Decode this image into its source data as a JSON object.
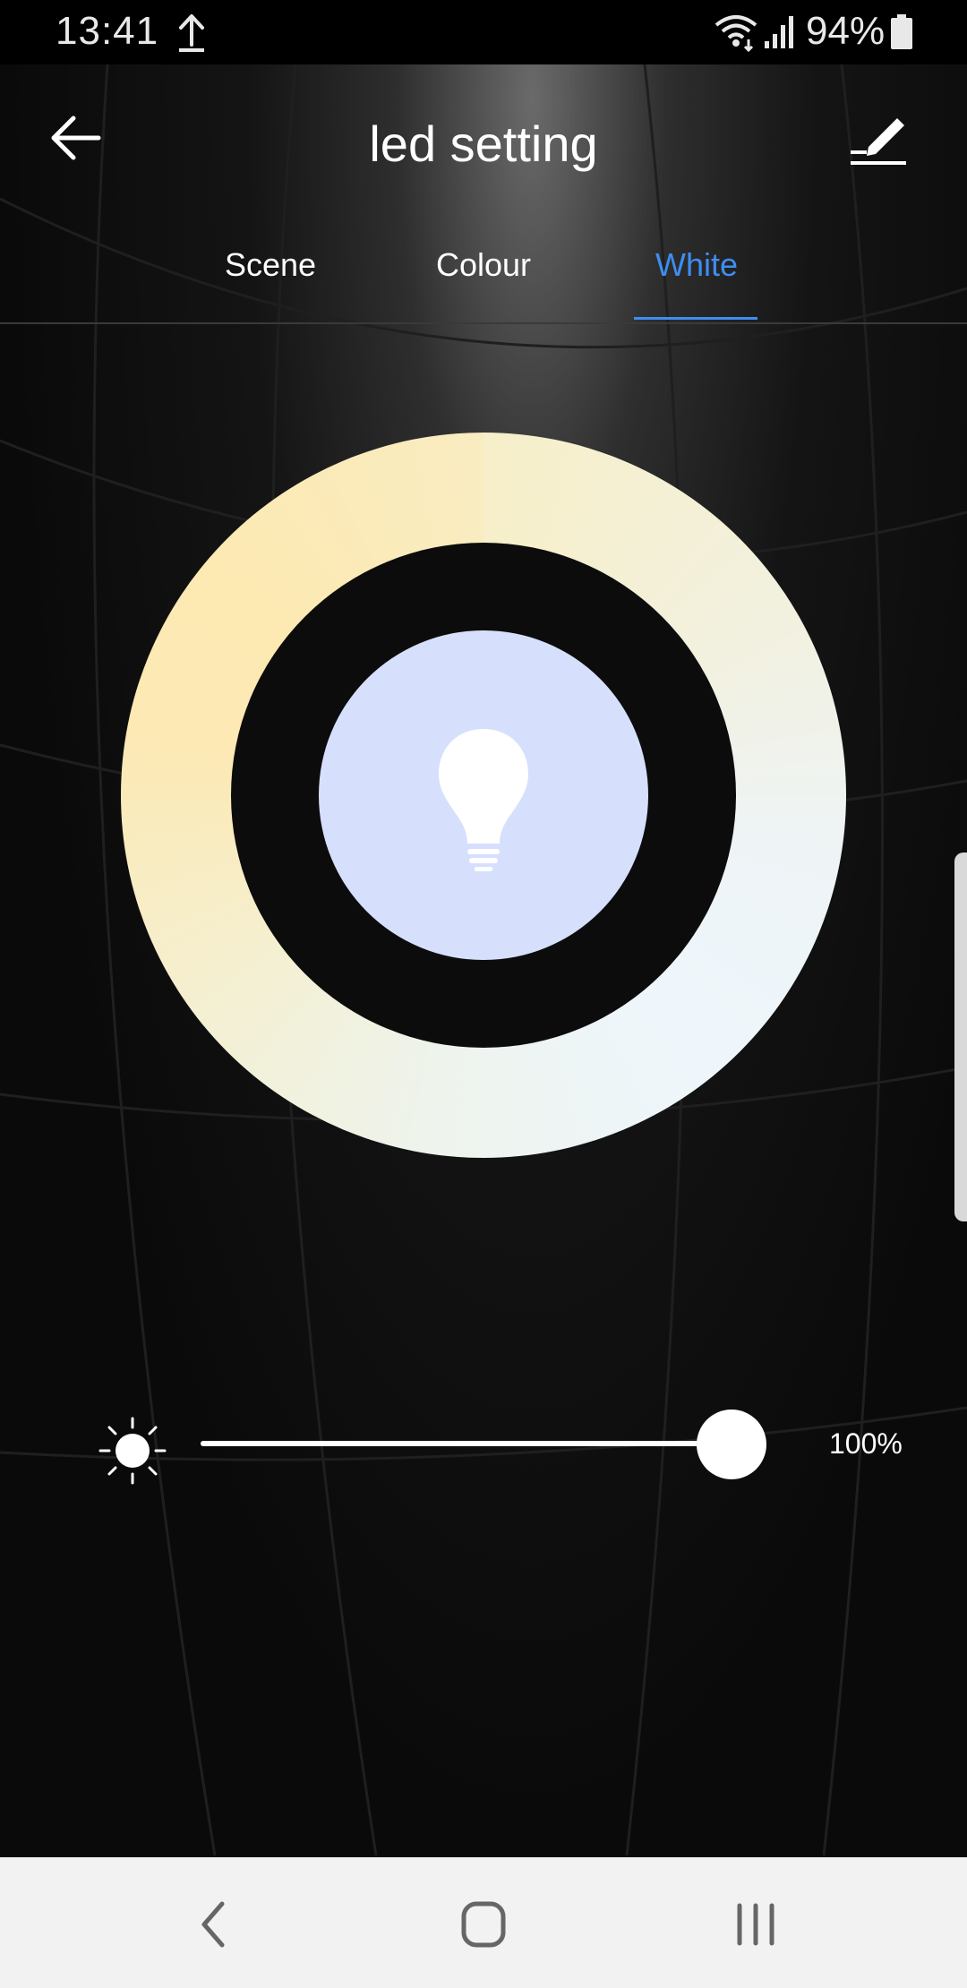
{
  "status_bar": {
    "time": "13:41",
    "battery": "94%",
    "icons": [
      "upload-icon",
      "wifi-icon",
      "signal-icon",
      "battery-icon"
    ]
  },
  "header": {
    "title": "led setting",
    "back_icon": "arrow-left-icon",
    "edit_icon": "edit-pencil-icon"
  },
  "tabs": [
    {
      "label": "Scene",
      "active": false
    },
    {
      "label": "Colour",
      "active": false
    },
    {
      "label": "White",
      "active": true
    }
  ],
  "colors": {
    "accent": "#3d8ef0",
    "bulb_background": "#d6e0fd",
    "warm_white": "#fde9b2",
    "cool_white": "#eef6fc"
  },
  "wheel": {
    "type": "color-temperature-ring",
    "center_icon": "light-bulb-icon"
  },
  "brightness": {
    "icon": "sun-icon",
    "level": 1.0,
    "value_label": "100%"
  },
  "nav_bar": {
    "icons": [
      "nav-back-icon",
      "nav-home-icon",
      "nav-recents-icon"
    ]
  }
}
